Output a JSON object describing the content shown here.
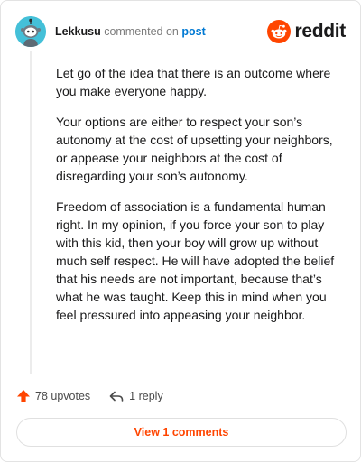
{
  "header": {
    "username": "Lekkusu",
    "action": " commented on ",
    "link": "post",
    "brand": "reddit"
  },
  "comment": {
    "paragraphs": [
      "Let go of the idea that there is an outcome where you make everyone happy.",
      "Your options are either to respect your son’s autonomy at the cost of upsetting your neighbors, or appease your neighbors at the cost of disregarding your son’s autonomy.",
      "Freedom of association is a fundamental human right. In my opinion, if you force your son to play with this kid, then your boy will grow up without much self respect. He will have adopted the belief that his needs are not important, because that’s what he was taught. Keep this in mind when you feel pressured into appeasing your neighbor."
    ]
  },
  "actions": {
    "upvotes": "78 upvotes",
    "replies": "1 reply"
  },
  "footer": {
    "view_label": "View 1 comments"
  },
  "colors": {
    "accent": "#ff4500",
    "link": "#0079d3",
    "avatar": "#44c0d8"
  },
  "icons": [
    "avatar-snoo",
    "reddit-logo-icon",
    "upvote-arrow-icon",
    "reply-arrow-icon"
  ]
}
